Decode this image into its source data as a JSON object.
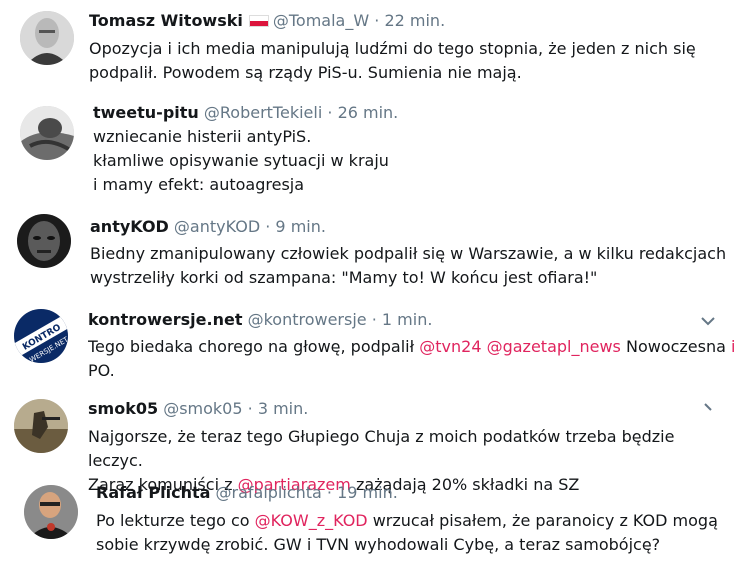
{
  "tweets": [
    {
      "name": "Tomasz Witowski",
      "handle": "@Tomala_W",
      "sep": "·",
      "time": "22 min.",
      "lines": [
        "Opozycja i ich media manipulują ludźmi do tego stopnia, że jeden z nich się",
        "podpalił. Powodem są rządy PiS-u. Sumienia nie mają."
      ]
    },
    {
      "name": "tweetu-pitu",
      "handle": "@RobertTekieli",
      "sep": "·",
      "time": "26 min.",
      "lines": [
        "wzniecanie histerii antyPiS.",
        "kłamliwe opisywanie sytuacji w kraju",
        "i mamy efekt: autoagresja"
      ]
    },
    {
      "name": "antyKOD",
      "handle": "@antyKOD",
      "sep": "·",
      "time": "9 min.",
      "lines": [
        "Biedny zmanipulowany człowiek podpalił się w Warszawie, a w kilku redakcjach",
        "wystrzeliły korki od szampana: \"Mamy to! W końcu jest ofiara!\""
      ]
    },
    {
      "name": "kontrowersje.net",
      "handle": "@kontrowersje",
      "sep": "·",
      "time": "1 min.",
      "line1_a": "Tego biedaka chorego na głowę, podpalił ",
      "mention1": "@tvn24",
      "mention2": "@gazetapl_news",
      "line1_b": " Nowoczesna ",
      "line1_i": "i",
      "line2": "PO.",
      "avatar_text_1": "KONTRO",
      "avatar_text_2": "WERSJE.NET"
    },
    {
      "name": "smok05",
      "handle": "@smok05",
      "sep": "·",
      "time": "3 min.",
      "line1": "Najgorsze, że teraz tego Głupiego Chuja z moich podatków trzeba będzie leczyc.",
      "line2_a": "Zaraz komuniści z ",
      "mention": "@partiarazem",
      "line2_b": " zażądają 20% składki na SZ"
    },
    {
      "name": "Rafał Plichta",
      "handle": "@rafalplichta",
      "sep": "·",
      "time": "19 min.",
      "line1_a": "Po lekturze tego co ",
      "mention": "@KOW_z_KOD",
      "line1_b": " wrzucał pisałem, że paranoicy z KOD mogą",
      "line2": "sobie krzywdę zrobić. GW i TVN wyhodowali Cybę, a teraz samobójcę?"
    }
  ],
  "icons": {
    "caret": "chevron-down-icon",
    "flag": "poland-flag-icon"
  },
  "colors": {
    "mention": "#e0245e",
    "meta": "#657786",
    "text": "#14171a"
  }
}
